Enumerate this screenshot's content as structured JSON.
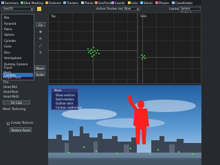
{
  "toolbar": {
    "items": [
      {
        "label": "Summary",
        "color": "#7fb3ff"
      },
      {
        "label": "Blob Masking",
        "color": "#5ad07a"
      },
      {
        "label": "Features",
        "color": "#f0b040"
      },
      {
        "label": "Trackers",
        "color": "#7fb3ff"
      },
      {
        "label": "Planar",
        "color": "#c9c9c9"
      },
      {
        "label": "GeoTrack",
        "color": "#ff8a5a"
      },
      {
        "label": "Coords",
        "color": "#c08aff"
      },
      {
        "label": "Lens",
        "color": "#ffd24a"
      },
      {
        "label": "Solver",
        "color": "#60d0ff"
      },
      {
        "label": "Phases",
        "color": "#ff6a9a"
      },
      {
        "label": "Coordinates",
        "color": "#9ac0ff"
      }
    ]
  },
  "row2": {
    "primitive_select": "GeoTrl",
    "active_tracker_host_label": "Active Tracker Host:",
    "active_tracker_host_value": "Bow",
    "layout_label": "Layout:",
    "layout_value": "Solver Output"
  },
  "dropdown": {
    "items": [
      "Box",
      "Pyramid",
      "Plane",
      "Sphere",
      "Cylinder",
      "Cone",
      "Disc",
      "Hemisphere",
      "Dummy Camera",
      "Lambda"
    ],
    "selected_index": 9
  },
  "left_panel": {
    "after_items": [
      "Tripod",
      "Mesh",
      "Helper Point",
      "Fire",
      "Head-Mid",
      "Head-Bow",
      "Head-Mid2"
    ],
    "small_buttons": [
      "Fix",
      "Fix",
      "Move",
      "Scale"
    ],
    "frame_label": "Fix Cuts",
    "mesh_texturing_label": "Mesh Texturing",
    "create_texture_label": "Create Texture",
    "texture_panel_button": "Texture Panel"
  },
  "viewport": {
    "top_left_label": "Top",
    "top_right_label": "Side",
    "bottom_left_label": "Left",
    "bottom_right_label": "Right"
  },
  "context_menu": {
    "header": "Mesh",
    "items": [
      "Show vertices",
      "Solid meshes",
      "Outline solid",
      "Contain subframes"
    ]
  }
}
